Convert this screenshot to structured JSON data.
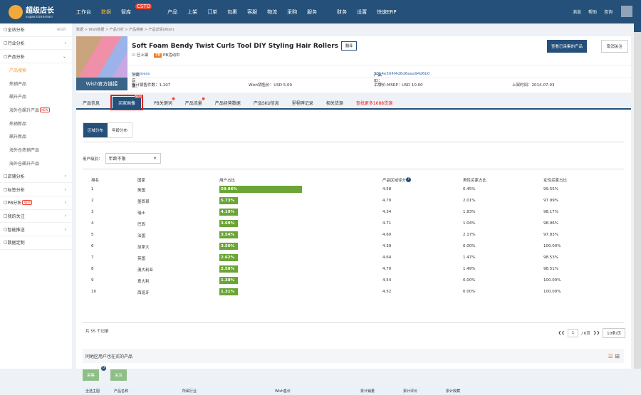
{
  "nav": {
    "brand": "超级店长",
    "brand_sub": "superstoreman",
    "items": [
      "工作台",
      "数据",
      "智库",
      "产品",
      "上架",
      "订单",
      "包裹",
      "客服",
      "物流",
      "采购",
      "服务",
      "财务",
      "设置",
      "快速ERP"
    ],
    "active": "数据",
    "badge": "CSTO",
    "right": [
      "消息",
      "帮助",
      "咨询"
    ]
  },
  "sidebar": {
    "platform": "wish",
    "items": [
      {
        "label": "全站分析",
        "kind": "top"
      },
      {
        "label": "行业分析",
        "kind": "group"
      },
      {
        "label": "产品分析",
        "kind": "group-open"
      },
      {
        "label": "产品搜索",
        "kind": "sub-active"
      },
      {
        "label": "热销产品",
        "kind": "sub"
      },
      {
        "label": "飙升产品",
        "kind": "sub"
      },
      {
        "label": "海外仓飙升产品",
        "kind": "sub",
        "tag": "NEW"
      },
      {
        "label": "热销新品",
        "kind": "sub"
      },
      {
        "label": "飙升新品",
        "kind": "sub"
      },
      {
        "label": "海外仓热销产品",
        "kind": "sub"
      },
      {
        "label": "海外仓飙升产品",
        "kind": "sub"
      },
      {
        "label": "店铺分析",
        "kind": "group"
      },
      {
        "label": "标签分析",
        "kind": "group"
      },
      {
        "label": "PB分析",
        "kind": "group",
        "tag": "NEW"
      },
      {
        "label": "我的关注",
        "kind": "group"
      },
      {
        "label": "智能推送",
        "kind": "group"
      },
      {
        "label": "数据定制",
        "kind": "top"
      }
    ]
  },
  "breadcrumb": "数据 > Wish数据 > 产品分析 > 产品搜索 > 产品详情(Wish)",
  "product": {
    "title": "Soft Foam Bendy Twist Curls Tool DIY Styling Hair Rollers",
    "translate": "翻译",
    "status": "已上架",
    "pb": "PB活动中",
    "wish_link": "Wish官方链接",
    "compare_btn": "查看已采集的产品",
    "fav_btn": "取消关注",
    "store_label": "所属店铺：",
    "store": "luckiness",
    "id_label": "产品ID：",
    "id": "53b4e504f4d6d6eea94d6b0",
    "sold": "累计销售件数：1,107",
    "price": "Wish销售价：USD 5.00",
    "msrp": "吊牌价-MSRP：USD 10.00",
    "date": "上架时间：2014-07-03"
  },
  "tabs": [
    "产品信息",
    "买家画像",
    "PB关键词",
    "产品流量",
    "产品经营数据",
    "产品SKU信息",
    "里程碑记录",
    "相关货源",
    "查找更多1688货源"
  ],
  "tab_new": "NEW",
  "segments": [
    "区域分布",
    "年龄分布"
  ],
  "filter": {
    "label": "用户级别：",
    "value": "年龄不限"
  },
  "table": {
    "headers": [
      "排名",
      "国家",
      "用户占比",
      "产品区域评分",
      "男性买家占比",
      "女性买家占比"
    ],
    "rows": [
      [
        "1",
        "美国",
        "59.96%",
        "4.58",
        "0.45%",
        "99.55%",
        59.96
      ],
      [
        "2",
        "墨西哥",
        "5.73%",
        "4.79",
        "2.01%",
        "97.99%",
        5.73
      ],
      [
        "3",
        "瑞士",
        "4.19%",
        "4.34",
        "1.83%",
        "98.17%",
        4.19
      ],
      [
        "4",
        "巴西",
        "3.69%",
        "4.71",
        "1.04%",
        "98.96%",
        3.69
      ],
      [
        "5",
        "法国",
        "3.54%",
        "4.60",
        "2.17%",
        "97.83%",
        3.54
      ],
      [
        "6",
        "加拿大",
        "3.50%",
        "4.39",
        "0.00%",
        "100.00%",
        3.5
      ],
      [
        "7",
        "英国",
        "2.62%",
        "4.64",
        "1.47%",
        "98.53%",
        2.62
      ],
      [
        "8",
        "澳大利亚",
        "2.58%",
        "4.70",
        "1.49%",
        "98.51%",
        2.58
      ],
      [
        "9",
        "意大利",
        "1.38%",
        "4.54",
        "0.00%",
        "100.00%",
        1.38
      ],
      [
        "10",
        "西班牙",
        "1.31%",
        "4.52",
        "0.00%",
        "100.00%",
        1.31
      ]
    ]
  },
  "pagination": {
    "total": "共 55 个记录",
    "page": "1",
    "pages": "/ 6页",
    "per_page": "10条/页"
  },
  "related": {
    "title": "同地区用户也在买的产品",
    "btn1": "采集",
    "btn2": "关注",
    "badge": "0",
    "headers": [
      "全选主图",
      "产品名称",
      "所属行业",
      "Wish售价",
      "累计销量",
      "累计评价",
      "累计收藏"
    ]
  }
}
